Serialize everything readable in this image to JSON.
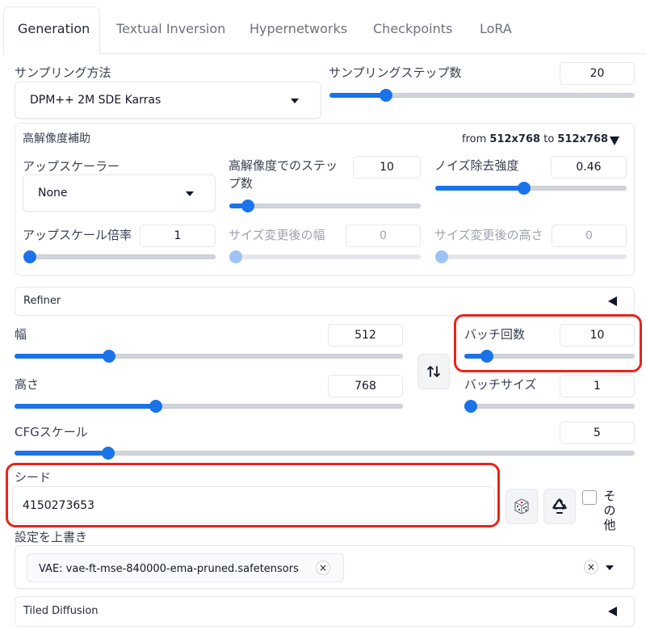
{
  "tabs": [
    {
      "label": "Generation",
      "active": true
    },
    {
      "label": "Textual Inversion",
      "active": false
    },
    {
      "label": "Hypernetworks",
      "active": false
    },
    {
      "label": "Checkpoints",
      "active": false
    },
    {
      "label": "LoRA",
      "active": false
    }
  ],
  "sampling": {
    "method_label": "サンプリング方法",
    "method_value": "DPM++ 2M SDE Karras",
    "steps_label": "サンプリングステップ数",
    "steps_value": "20",
    "steps_fraction": 0.17
  },
  "hires": {
    "title": "高解像度補助",
    "from_prefix": "from",
    "from_value": "512x768",
    "to_prefix": "to",
    "to_value": "512x768",
    "upscaler_label": "アップスケーラー",
    "upscaler_value": "None",
    "steps_label_line1": "高解像度でのステッ",
    "steps_label_line2": "プ数",
    "steps_value": "10",
    "steps_fraction": 0.07,
    "denoise_label": "ノイズ除去強度",
    "denoise_value": "0.46",
    "denoise_fraction": 0.46,
    "scale_label": "アップスケール倍率",
    "scale_value": "1",
    "scale_fraction": 0.0,
    "resize_w_label": "サイズ変更後の幅",
    "resize_w_value": "0",
    "resize_h_label": "サイズ変更後の高さ",
    "resize_h_value": "0"
  },
  "refiner": {
    "title": "Refiner"
  },
  "size": {
    "width_label": "幅",
    "width_value": "512",
    "width_fraction": 0.235,
    "height_label": "高さ",
    "height_value": "768",
    "height_fraction": 0.36,
    "swap_icon": "swap-arrows-icon"
  },
  "batch": {
    "count_label": "バッチ回数",
    "count_value": "10",
    "count_fraction": 0.1,
    "size_label": "バッチサイズ",
    "size_value": "1",
    "size_fraction": 0.0
  },
  "cfg": {
    "label": "CFGスケール",
    "value": "5",
    "fraction": 0.143
  },
  "seed": {
    "label": "シード",
    "value": "4150273653",
    "extra_label": "その他"
  },
  "override": {
    "label": "設定を上書き",
    "chip": "VAE: vae-ft-mse-840000-ema-pruned.safetensors"
  },
  "tiled": {
    "title": "Tiled Diffusion"
  },
  "colors": {
    "accent": "#1a73e8",
    "highlight": "#e8241c"
  }
}
